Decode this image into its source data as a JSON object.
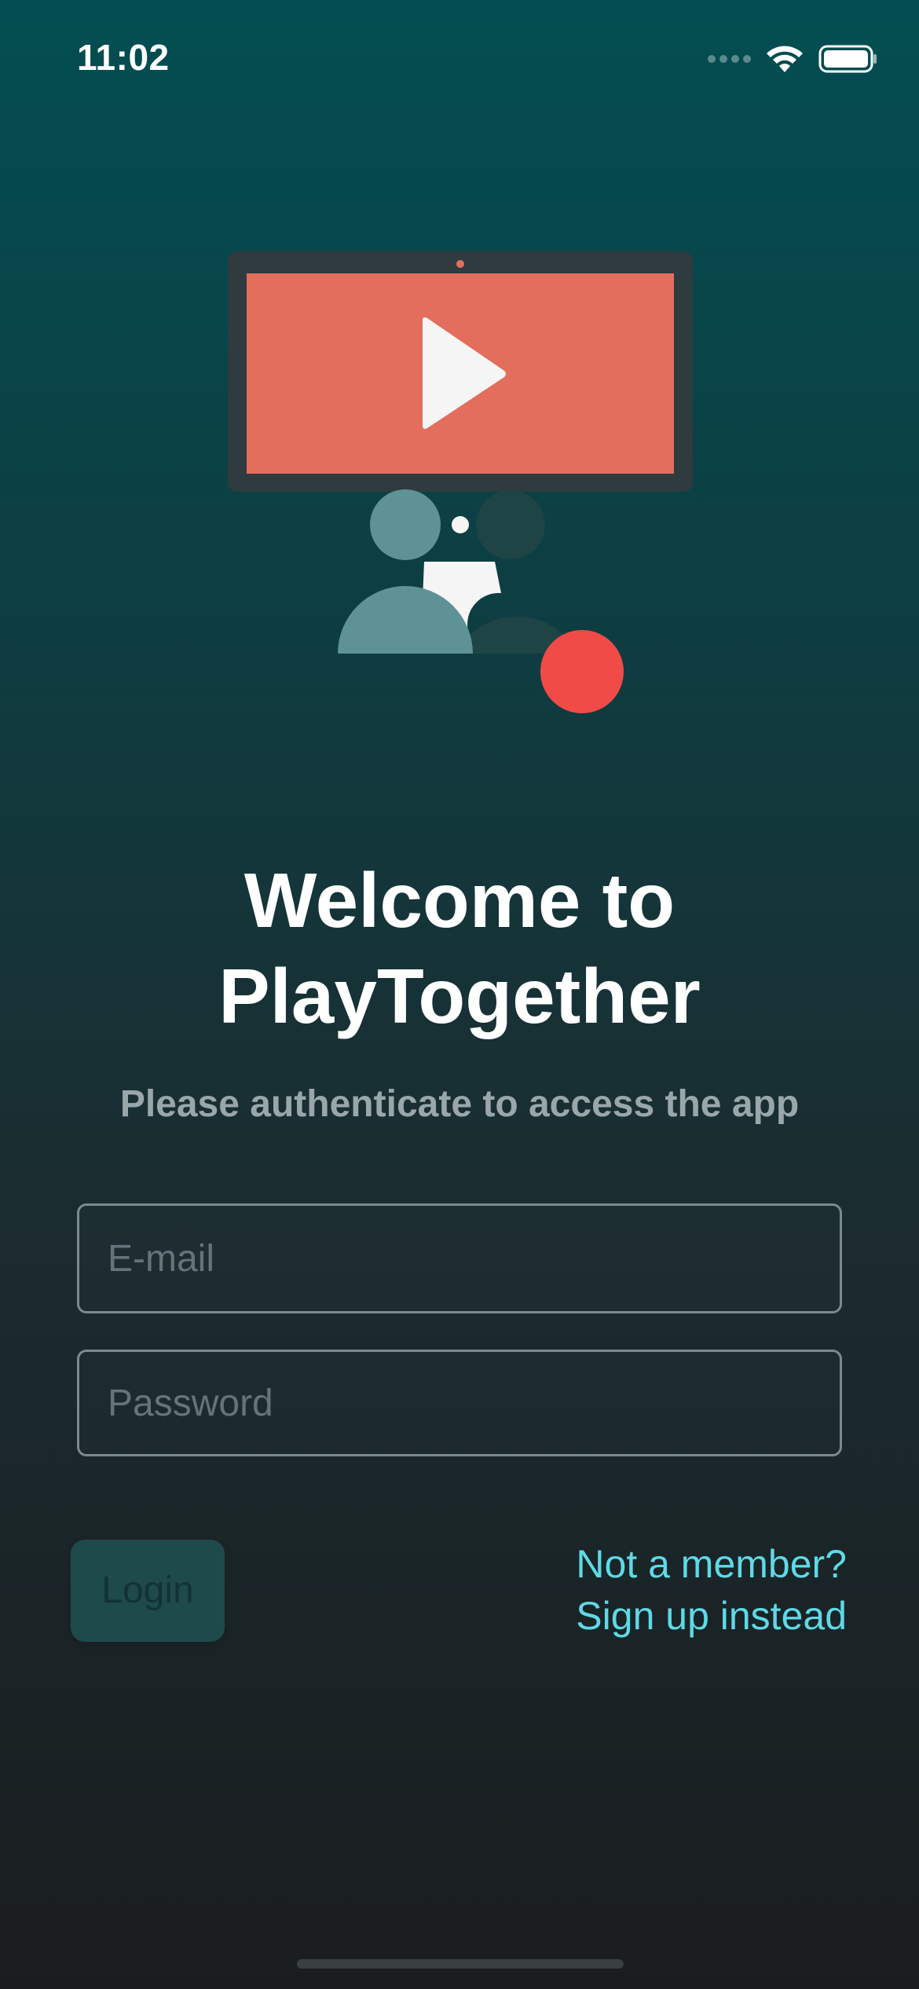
{
  "status_bar": {
    "time": "11:02",
    "icons": [
      "cellular-signal-icon",
      "wifi-icon",
      "battery-icon"
    ]
  },
  "illustration": {
    "icon": "video-watch-party-illustration",
    "colors": {
      "screen": "#e36e5e",
      "monitor_frame": "#2f3b3f",
      "play": "#f5f5f5",
      "person_light": "#5f9297",
      "person_dark": "#1e4446",
      "record_dot": "#f14b47"
    }
  },
  "title": {
    "line1": "Welcome to",
    "line2": "PlayTogether"
  },
  "subtitle": "Please authenticate to access the app",
  "form": {
    "email_placeholder": "E-mail",
    "password_placeholder": "Password",
    "login_label": "Login",
    "signup_line1": "Not a member?",
    "signup_line2": "Sign up instead"
  },
  "colors": {
    "accent": "#5fd9e6",
    "background_top": "#034e52",
    "background_bottom": "#1a1d1f"
  }
}
